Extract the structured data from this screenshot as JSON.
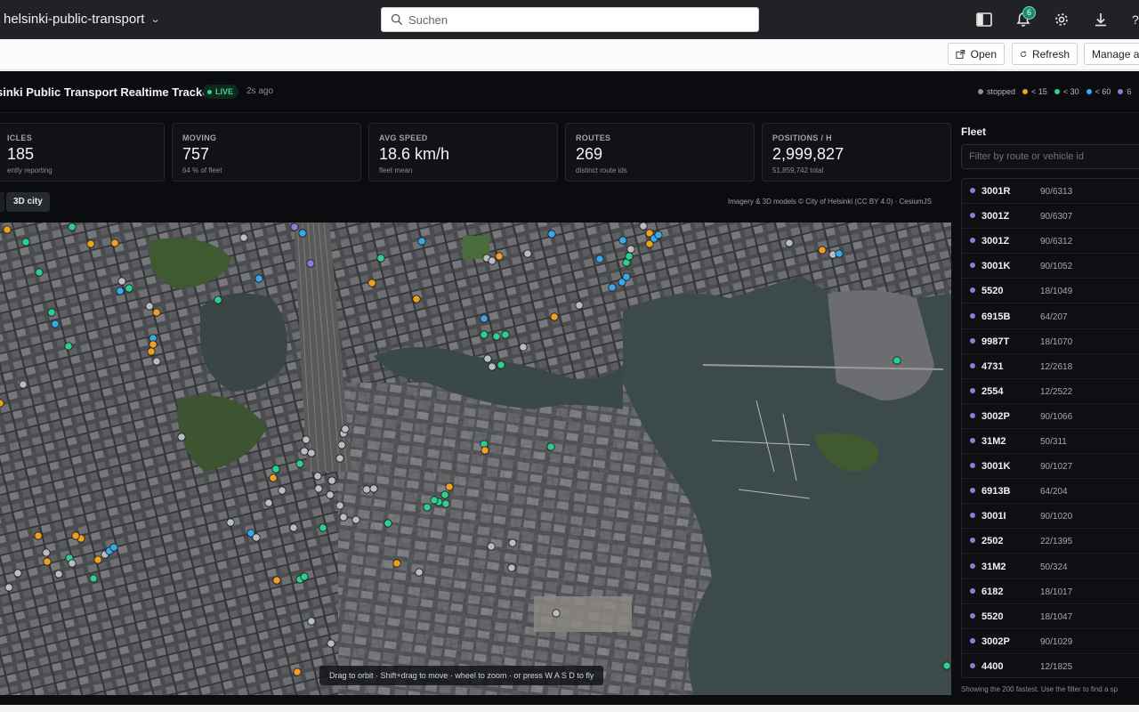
{
  "topbar": {
    "project": "helsinki-public-transport",
    "search_placeholder": "Suchen",
    "notifications_count": "6"
  },
  "toolbar": {
    "open_label": "Open",
    "refresh_label": "Refresh",
    "manage_label": "Manage ap"
  },
  "header": {
    "title": "sinki Public Transport Realtime Tracker",
    "live_label": "LIVE",
    "updated": "2s ago"
  },
  "legend": [
    {
      "label": "stopped",
      "color": "#8b8f96"
    },
    {
      "label": "< 15",
      "color": "#f0a020"
    },
    {
      "label": "< 30",
      "color": "#2ecf8c"
    },
    {
      "label": "< 60",
      "color": "#38a8e8"
    },
    {
      "label": "6",
      "color": "#8b7fd9"
    }
  ],
  "stats": {
    "vehicles": {
      "label": "ICLES",
      "value": "185",
      "sub": "ently reporting"
    },
    "moving": {
      "label": "MOVING",
      "value": "757",
      "sub": "64 % of fleet"
    },
    "avg_speed": {
      "label": "AVG SPEED",
      "value": "18.6 km/h",
      "sub": "fleet mean"
    },
    "routes": {
      "label": "ROUTES",
      "value": "269",
      "sub": "distinct route ids"
    },
    "positions": {
      "label": "POSITIONS / H",
      "value": "2,999,827",
      "sub": "51,859,742 total"
    }
  },
  "map": {
    "mode_button": "3D city",
    "attribution": "Imagery & 3D models © City of Helsinki (CC BY 4.0) · CesiumJS",
    "hint": "Drag to orbit · Shift+drag to move · wheel to zoom · or press W A S D to fly"
  },
  "fleet": {
    "title": "Fleet",
    "filter_placeholder": "Filter by route or vehicle id",
    "rows": [
      {
        "id": "3001R",
        "ref": "90/6313"
      },
      {
        "id": "3001Z",
        "ref": "90/6307"
      },
      {
        "id": "3001Z",
        "ref": "90/6312"
      },
      {
        "id": "3001K",
        "ref": "90/1052"
      },
      {
        "id": "5520",
        "ref": "18/1049"
      },
      {
        "id": "6915B",
        "ref": "64/207"
      },
      {
        "id": "9987T",
        "ref": "18/1070"
      },
      {
        "id": "4731",
        "ref": "12/2618"
      },
      {
        "id": "2554",
        "ref": "12/2522"
      },
      {
        "id": "3002P",
        "ref": "90/1066"
      },
      {
        "id": "31M2",
        "ref": "50/311"
      },
      {
        "id": "3001K",
        "ref": "90/1027"
      },
      {
        "id": "6913B",
        "ref": "64/204"
      },
      {
        "id": "3001I",
        "ref": "90/1020"
      },
      {
        "id": "2502",
        "ref": "22/1395"
      },
      {
        "id": "31M2",
        "ref": "50/324"
      },
      {
        "id": "6182",
        "ref": "18/1017"
      },
      {
        "id": "5520",
        "ref": "18/1047"
      },
      {
        "id": "3002P",
        "ref": "90/1029"
      },
      {
        "id": "4400",
        "ref": "12/1825"
      }
    ],
    "footer": "Showing the 200 fastest. Use the filter to find a sp"
  }
}
